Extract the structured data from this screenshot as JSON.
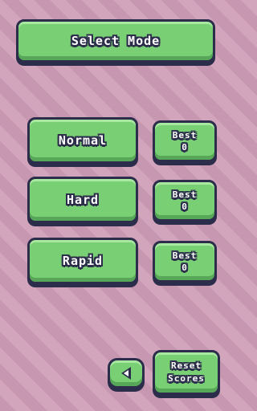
{
  "header": {
    "title": "Select Mode"
  },
  "modes": [
    {
      "label": "Normal",
      "best_label": "Best",
      "best_value": "0"
    },
    {
      "label": "Hard",
      "best_label": "Best",
      "best_value": "0"
    },
    {
      "label": "Rapid",
      "best_label": "Best",
      "best_value": "0"
    }
  ],
  "footer": {
    "back_icon": "triangle-left",
    "reset_line1": "Reset",
    "reset_line2": "Scores"
  },
  "colors": {
    "button_fill": "#79cf73",
    "outline": "#2b2d4a",
    "background": "#cc9bb4"
  }
}
